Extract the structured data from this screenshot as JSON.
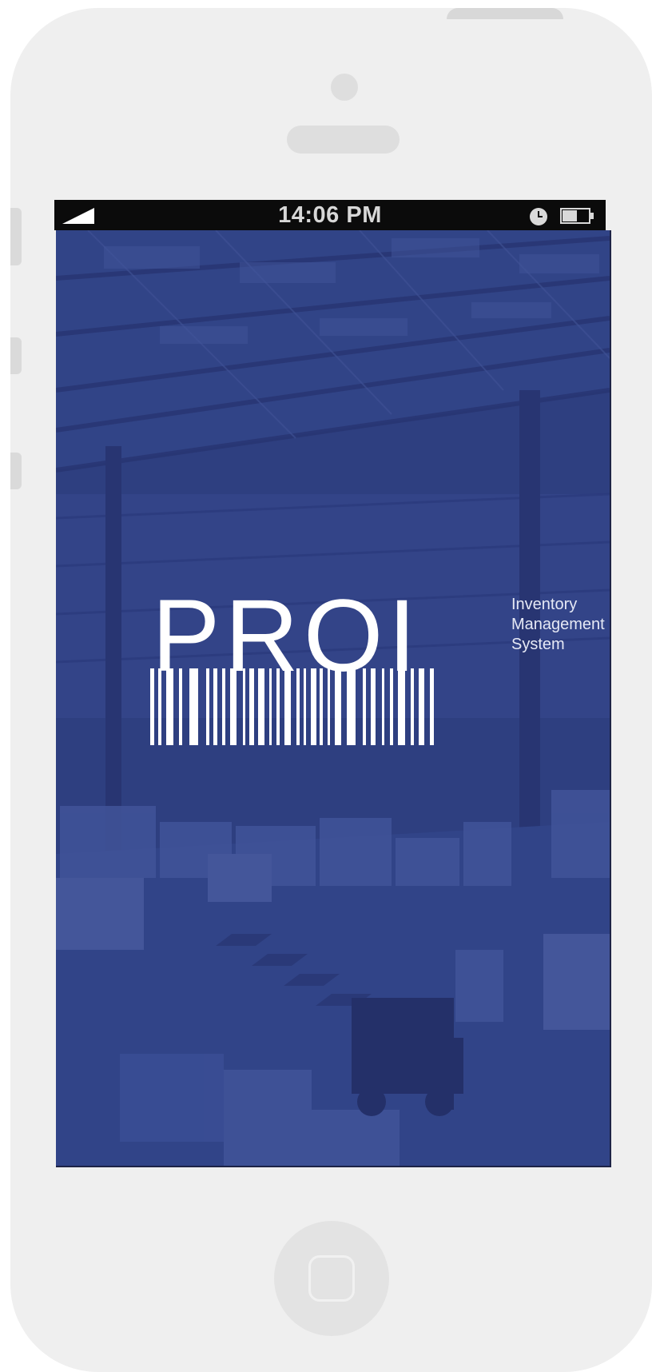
{
  "status_bar": {
    "time": "14:06 PM",
    "icons": [
      "signal-icon",
      "clock-icon",
      "battery-icon"
    ]
  },
  "splash": {
    "logo_text": "PROI",
    "tagline": [
      "Inventory",
      "Management",
      "System"
    ],
    "background": "warehouse photo with blue overlay"
  },
  "colors": {
    "screen_overlay": "#2f3f80",
    "status_bar": "#0b0b0b",
    "phone_frame": "#efefef",
    "logo": "#ffffff"
  }
}
